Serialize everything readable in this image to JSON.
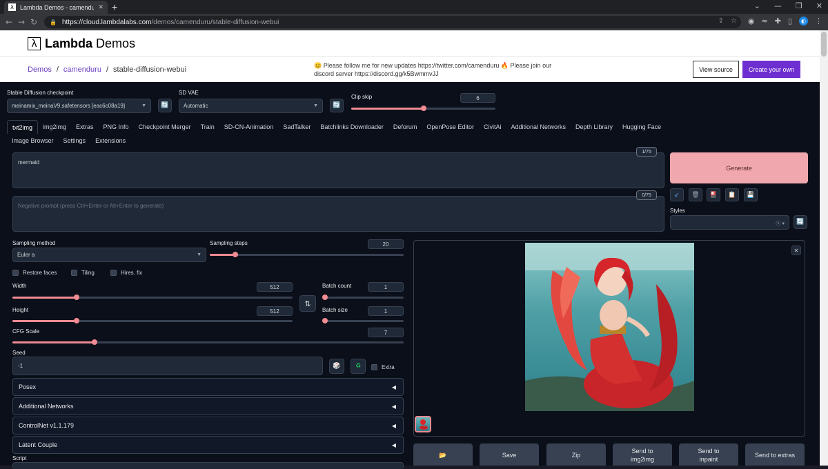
{
  "browser": {
    "tab_title": "Lambda Demos - camenduru/sta",
    "url_host": "https://cloud.lambdalabs.com",
    "url_path": "/demos/camenduru/stable-diffusion-webui"
  },
  "header": {
    "brand_bold": "Lambda",
    "brand_rest": " Demos",
    "breadcrumb": [
      "Demos",
      "camenduru",
      "stable-diffusion-webui"
    ],
    "notice": "😊 Please follow me for new updates https://twitter.com/camenduru 🔥 Please join our discord server https://discord.gg/k5BwmmvJJ",
    "view_source": "View source",
    "create_own": "Create your own"
  },
  "top": {
    "checkpoint_label": "Stable Diffusion checkpoint",
    "checkpoint_value": "meinamix_meinaV9.safetensors [eac6c08a19]",
    "vae_label": "SD VAE",
    "vae_value": "Automatic",
    "clip_label": "Clip skip",
    "clip_value": "6",
    "clip_fraction": 0.5
  },
  "tabs_row1": [
    "txt2img",
    "img2img",
    "Extras",
    "PNG Info",
    "Checkpoint Merger",
    "Train",
    "SD-CN-Animation",
    "SadTalker",
    "Batchlinks Downloader",
    "Deforum",
    "OpenPose Editor",
    "CivitAi",
    "Additional Networks",
    "Depth Library",
    "Hugging Face"
  ],
  "tabs_row2": [
    "Image Browser",
    "Settings",
    "Extensions"
  ],
  "prompt": {
    "positive": "mermaid",
    "positive_count": "1/75",
    "negative_placeholder": "Negative prompt (press Ctrl+Enter or Alt+Enter to generate)",
    "negative_count": "0/75"
  },
  "generate_label": "Generate",
  "styles_label": "Styles",
  "params": {
    "sampling_method_label": "Sampling method",
    "sampling_method": "Euler a",
    "sampling_steps_label": "Sampling steps",
    "sampling_steps": "20",
    "restore_faces": "Restore faces",
    "tiling": "Tiling",
    "hires_fix": "Hires. fix",
    "width_label": "Width",
    "width": "512",
    "height_label": "Height",
    "height": "512",
    "batch_count_label": "Batch count",
    "batch_count": "1",
    "batch_size_label": "Batch size",
    "batch_size": "1",
    "cfg_label": "CFG Scale",
    "cfg": "7",
    "seed_label": "Seed",
    "seed": "-1",
    "extra": "Extra",
    "script_label": "Script"
  },
  "accordions": [
    "Posex",
    "Additional Networks",
    "ControlNet v1.1.179",
    "Latent Couple"
  ],
  "actions": [
    "📂",
    "Save",
    "Zip",
    "Send to img2img",
    "Send to inpaint",
    "Send to extras"
  ],
  "colors": {
    "accent": "#f28b93",
    "generate": "#f0a8ae",
    "brand_purple": "#6e2fd1"
  }
}
